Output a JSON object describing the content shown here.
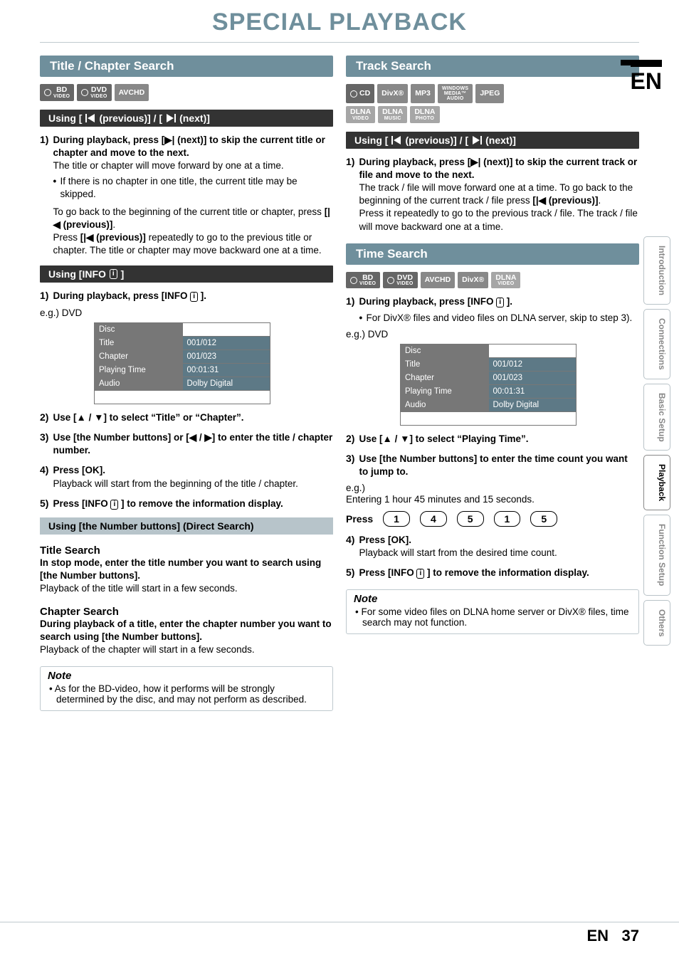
{
  "page_title": "SPECIAL PLAYBACK",
  "lang_code": "EN",
  "page_number": "37",
  "sidebar": {
    "items": [
      {
        "label": "Introduction",
        "active": false
      },
      {
        "label": "Connections",
        "active": false
      },
      {
        "label": "Basic Setup",
        "active": false
      },
      {
        "label": "Playback",
        "active": true
      },
      {
        "label": "Function Setup",
        "active": false
      },
      {
        "label": "Others",
        "active": false
      }
    ]
  },
  "left": {
    "section_title": "Title / Chapter Search",
    "badges": [
      "BD VIDEO",
      "DVD VIDEO",
      "AVCHD"
    ],
    "bar_prev_next_pre": "Using [",
    "bar_prev_label": " (previous)] / [",
    "bar_next_label": " (next)]",
    "step1": {
      "label": "1)",
      "bold": "During playback, press [▶| (next)] to skip the current title or chapter and move to the next.",
      "line": "The title or chapter will move forward by one at a time.",
      "bullet": "If there is no chapter in one title, the current title may be skipped.",
      "para2a": "To go back to the beginning of the current title or chapter, press ",
      "para2b": "[|◀ (previous)]",
      "para2c": ".",
      "para3a": "Press ",
      "para3b": "[|◀ (previous)]",
      "para3c": " repeatedly to go to the previous title or chapter. The title or chapter may move backward one at a time."
    },
    "bar_info_pre": "Using [INFO ",
    "bar_info_post": " ]",
    "info_step1_label": "1)",
    "info_step1_bold": "During playback, press [INFO ",
    "info_step1_bold_post": " ].",
    "eg_label": "e.g.) DVD",
    "info_table": [
      {
        "lab": "Disc",
        "val": ""
      },
      {
        "lab": "Title",
        "val": "001/012"
      },
      {
        "lab": "Chapter",
        "val": "001/023"
      },
      {
        "lab": "Playing Time",
        "val": "00:01:31"
      },
      {
        "lab": "Audio",
        "val": "Dolby Digital"
      }
    ],
    "step2_label": "2)",
    "step2_bold": "Use [▲ / ▼] to select “Title” or “Chapter”.",
    "step3_label": "3)",
    "step3_bold": "Use [the Number buttons] or [◀ / ▶] to enter the title / chapter number.",
    "step4_label": "4)",
    "step4_bold": "Press [OK].",
    "step4_line": "Playback will start from the beginning of the title / chapter.",
    "step5_label": "5)",
    "step5_bold_pre": "Press [INFO ",
    "step5_bold_post": " ] to remove the information display.",
    "numbar": "Using [the Number buttons] (Direct Search)",
    "title_search_head": "Title Search",
    "title_search_bold": "In stop mode, enter the title number you want to search using [the Number buttons].",
    "title_search_line": "Playback of the title will start in a few seconds.",
    "chapter_search_head": "Chapter Search",
    "chapter_search_bold": "During playback of a title, enter the chapter number you want to search using [the Number buttons].",
    "chapter_search_line": "Playback of the chapter will start in a few seconds.",
    "note_title": "Note",
    "note_body": "• As for the BD-video, how it performs will be strongly determined by the disc, and may not perform as described."
  },
  "right": {
    "section_title": "Track Search",
    "badges_row1": [
      "CD",
      "DivX®",
      "MP3",
      "WINDOWS MEDIA™ AUDIO",
      "JPEG"
    ],
    "badges_row2": [
      "DLNA VIDEO",
      "DLNA MUSIC",
      "DLNA PHOTO"
    ],
    "bar_prev_next_pre": "Using [",
    "bar_prev_label": " (previous)] / [",
    "bar_next_label": " (next)]",
    "step1": {
      "label": "1)",
      "bold": "During playback, press [▶| (next)] to skip the current track or file and move to the next.",
      "line_a": "The track / file will move forward one at a time. To go back to the beginning of the current track / file press ",
      "line_b": "[|◀ (previous)]",
      "line_c": ".",
      "line2": "Press it repeatedly to go to the previous track / file. The track / file will move backward one at a time."
    },
    "time_title": "Time Search",
    "time_badges": [
      "BD VIDEO",
      "DVD VIDEO",
      "AVCHD",
      "DivX®",
      "DLNA VIDEO"
    ],
    "t_step1_label": "1)",
    "t_step1_bold": "During playback, press [INFO ",
    "t_step1_bold_post": " ].",
    "t_step1_bullet": "For DivX® files and video files on DLNA server, skip to step 3).",
    "t_eg_label": "e.g.) DVD",
    "t_info_table": [
      {
        "lab": "Disc",
        "val": ""
      },
      {
        "lab": "Title",
        "val": "001/012"
      },
      {
        "lab": "Chapter",
        "val": "001/023"
      },
      {
        "lab": "Playing Time",
        "val": "00:01:31"
      },
      {
        "lab": "Audio",
        "val": "Dolby Digital"
      }
    ],
    "t_step2_label": "2)",
    "t_step2_bold": "Use [▲ / ▼] to select “Playing Time”.",
    "t_step3_label": "3)",
    "t_step3_bold": "Use [the Number buttons] to enter the time count you want to jump to.",
    "t_eg2_label": "e.g.)",
    "t_eg2_line": "Entering 1 hour 45 minutes and 15 seconds.",
    "press_label": "Press",
    "keys": [
      "1",
      "4",
      "5",
      "1",
      "5"
    ],
    "t_step4_label": "4)",
    "t_step4_bold": "Press [OK].",
    "t_step4_line": "Playback will start from the desired time count.",
    "t_step5_label": "5)",
    "t_step5_bold_pre": "Press [INFO ",
    "t_step5_bold_post": " ] to remove the information display.",
    "note_title": "Note",
    "note_body": "• For some video files on DLNA home server or DivX® files, time search may not function."
  }
}
